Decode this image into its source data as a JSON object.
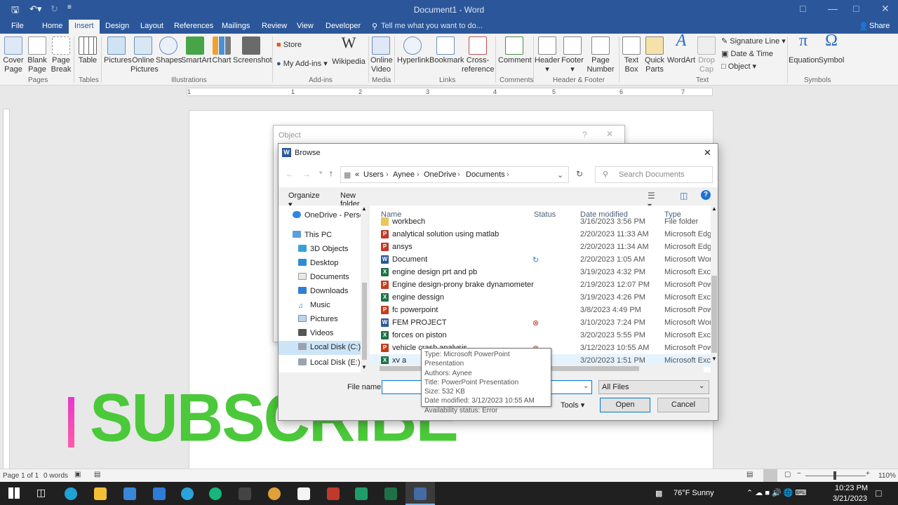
{
  "titlebar": {
    "title": "Document1  -  Word"
  },
  "tabs": [
    "File",
    "Home",
    "Insert",
    "Design",
    "Layout",
    "References",
    "Mailings",
    "Review",
    "View",
    "Developer"
  ],
  "tell_me": "Tell me what you want to do...",
  "share": "Share",
  "ribbon": {
    "pages": [
      "Cover Page",
      "Blank Page",
      "Page Break"
    ],
    "tables": "Table",
    "illus": [
      "Pictures",
      "Online Pictures",
      "Shapes",
      "SmartArt",
      "Chart",
      "Screenshot"
    ],
    "addins": [
      "Store",
      "My Add-ins",
      "Wikipedia"
    ],
    "media": "Online Video",
    "links": [
      "Hyperlink",
      "Bookmark",
      "Cross-reference"
    ],
    "comment": "Comment",
    "hf": [
      "Header",
      "Footer",
      "Page Number"
    ],
    "text": [
      "Text Box",
      "Quick Parts",
      "WordArt",
      "Drop Cap"
    ],
    "text_small": [
      "Signature Line",
      "Date & Time",
      "Object"
    ],
    "symbols": [
      "Equation",
      "Symbol"
    ],
    "groups": [
      "Pages",
      "Tables",
      "Illustrations",
      "Add-ins",
      "Media",
      "Links",
      "Comments",
      "Header & Footer",
      "Text",
      "Symbols"
    ]
  },
  "ruler_numbers": [
    "1",
    "1",
    "2",
    "3",
    "4",
    "5",
    "6",
    "7"
  ],
  "object_dialog": {
    "title": "Object"
  },
  "browse": {
    "title": "Browse",
    "path": [
      "«",
      "Users",
      "Aynee",
      "OneDrive",
      "Documents"
    ],
    "search_placeholder": "Search Documents",
    "organize": "Organize",
    "new_folder": "New folder",
    "tree": [
      "OneDrive - Person",
      "This PC",
      "3D Objects",
      "Desktop",
      "Documents",
      "Downloads",
      "Music",
      "Pictures",
      "Videos",
      "Local Disk (C:)",
      "Local Disk (E:)"
    ],
    "columns": [
      "Name",
      "Status",
      "Date modified",
      "Type"
    ],
    "files": [
      {
        "name": "workbech",
        "date": "3/16/2023 3:56 PM",
        "type": "File folder",
        "kind": "folder",
        "status": ""
      },
      {
        "name": "analytical solution using matlab",
        "date": "2/20/2023 11:33 AM",
        "type": "Microsoft Edg",
        "kind": "pdf",
        "status": ""
      },
      {
        "name": "ansys",
        "date": "2/20/2023 11:34 AM",
        "type": "Microsoft Edg",
        "kind": "pdf",
        "status": ""
      },
      {
        "name": "Document",
        "date": "2/20/2023 1:05 AM",
        "type": "Microsoft Wor",
        "kind": "word",
        "status": "sync"
      },
      {
        "name": "engine design prt and pb",
        "date": "3/19/2023 4:32 PM",
        "type": "Microsoft Exce",
        "kind": "excel",
        "status": ""
      },
      {
        "name": "Engine design-prony brake dynamometer",
        "date": "2/19/2023 12:07 PM",
        "type": "Microsoft Pow",
        "kind": "ppt",
        "status": ""
      },
      {
        "name": "engine dessign",
        "date": "3/19/2023 4:26 PM",
        "type": "Microsoft Exce",
        "kind": "excel",
        "status": ""
      },
      {
        "name": "fc powerpoint",
        "date": "3/8/2023 4:49 PM",
        "type": "Microsoft Pow",
        "kind": "ppt",
        "status": ""
      },
      {
        "name": "FEM PROJECT",
        "date": "3/10/2023 7:24 PM",
        "type": "Microsoft Wor",
        "kind": "word",
        "status": "error"
      },
      {
        "name": "forces on piston",
        "date": "3/20/2023 5:55 PM",
        "type": "Microsoft Exce",
        "kind": "excel",
        "status": ""
      },
      {
        "name": "vehicle crash analysis",
        "date": "3/12/2023 10:55 AM",
        "type": "Microsoft Pow",
        "kind": "ppt",
        "status": "error"
      },
      {
        "name": "xv a",
        "date": "3/20/2023 1:51 PM",
        "type": "Microsoft Exce",
        "kind": "excel",
        "status": ""
      }
    ],
    "file_name_label": "File name:",
    "file_name_value": "",
    "filter": "All Files",
    "tools": "Tools",
    "open": "Open",
    "cancel": "Cancel"
  },
  "tooltip": [
    "Type: Microsoft PowerPoint Presentation",
    "Authors: Aynee",
    "Title: PowerPoint Presentation",
    "Size: 532 KB",
    "Date modified: 3/12/2023 10:55 AM",
    "Availability status: Error"
  ],
  "overlay": {
    "subscribe": "SUBSCRIBE"
  },
  "statusbar": {
    "page": "Page 1 of 1",
    "words": "0 words",
    "zoom": "110%"
  },
  "taskbar": {
    "weather": "76°F  Sunny",
    "time": "10:23 PM",
    "date": "3/21/2023"
  },
  "colors": {
    "word_blue": "#2b579a",
    "excel": "#1e7145",
    "ppt": "#c43e1c",
    "pdf": "#c0392b",
    "subscribe": "#4cc93a"
  }
}
